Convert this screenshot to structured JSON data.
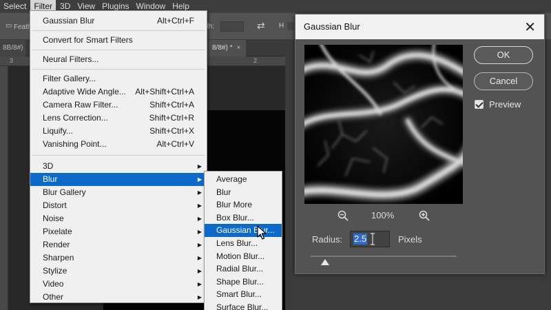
{
  "menubar": {
    "items": [
      "Select",
      "Filter",
      "3D",
      "View",
      "Plugins",
      "Window",
      "Help"
    ],
    "active": "Filter"
  },
  "options_bar": {
    "feather_label": "Feath",
    "width_label": "th:"
  },
  "doc_tabs": {
    "left_label": "8B/8#)",
    "right_label": "8/8#) *",
    "close_glyph": "×"
  },
  "ruler": {
    "marks": [
      "3",
      "2"
    ]
  },
  "filter_menu": {
    "groups": [
      [
        {
          "label": "Gaussian Blur",
          "shortcut": "Alt+Ctrl+F"
        }
      ],
      [
        {
          "label": "Convert for Smart Filters",
          "shortcut": ""
        }
      ],
      [
        {
          "label": "Neural Filters...",
          "shortcut": ""
        }
      ],
      [
        {
          "label": "Filter Gallery...",
          "shortcut": ""
        },
        {
          "label": "Adaptive Wide Angle...",
          "shortcut": "Alt+Shift+Ctrl+A"
        },
        {
          "label": "Camera Raw Filter...",
          "shortcut": "Shift+Ctrl+A"
        },
        {
          "label": "Lens Correction...",
          "shortcut": "Shift+Ctrl+R"
        },
        {
          "label": "Liquify...",
          "shortcut": "Shift+Ctrl+X"
        },
        {
          "label": "Vanishing Point...",
          "shortcut": "Alt+Ctrl+V"
        }
      ],
      [
        {
          "label": "3D",
          "submenu": true
        },
        {
          "label": "Blur",
          "submenu": true,
          "active": true
        },
        {
          "label": "Blur Gallery",
          "submenu": true
        },
        {
          "label": "Distort",
          "submenu": true
        },
        {
          "label": "Noise",
          "submenu": true
        },
        {
          "label": "Pixelate",
          "submenu": true
        },
        {
          "label": "Render",
          "submenu": true
        },
        {
          "label": "Sharpen",
          "submenu": true
        },
        {
          "label": "Stylize",
          "submenu": true
        },
        {
          "label": "Video",
          "submenu": true
        },
        {
          "label": "Other",
          "submenu": true
        }
      ]
    ]
  },
  "blur_submenu": {
    "items": [
      {
        "label": "Average"
      },
      {
        "label": "Blur"
      },
      {
        "label": "Blur More"
      },
      {
        "label": "Box Blur..."
      },
      {
        "label": "Gaussian Blur...",
        "active": true
      },
      {
        "label": "Lens Blur..."
      },
      {
        "label": "Motion Blur..."
      },
      {
        "label": "Radial Blur..."
      },
      {
        "label": "Shape Blur..."
      },
      {
        "label": "Smart Blur..."
      },
      {
        "label": "Surface Blur..."
      }
    ]
  },
  "dialog": {
    "title": "Gaussian Blur",
    "close_glyph": "✕",
    "ok_label": "OK",
    "cancel_label": "Cancel",
    "preview_label": "Preview",
    "preview_checked": true,
    "zoom_value": "100%",
    "radius_label": "Radius:",
    "radius_value": "2.5",
    "units_label": "Pixels",
    "slider_fraction": 0.1
  },
  "colors": {
    "menu_highlight": "#0e6ac8",
    "dialog_bg": "#535353",
    "menu_bg": "#f0f0f0"
  }
}
